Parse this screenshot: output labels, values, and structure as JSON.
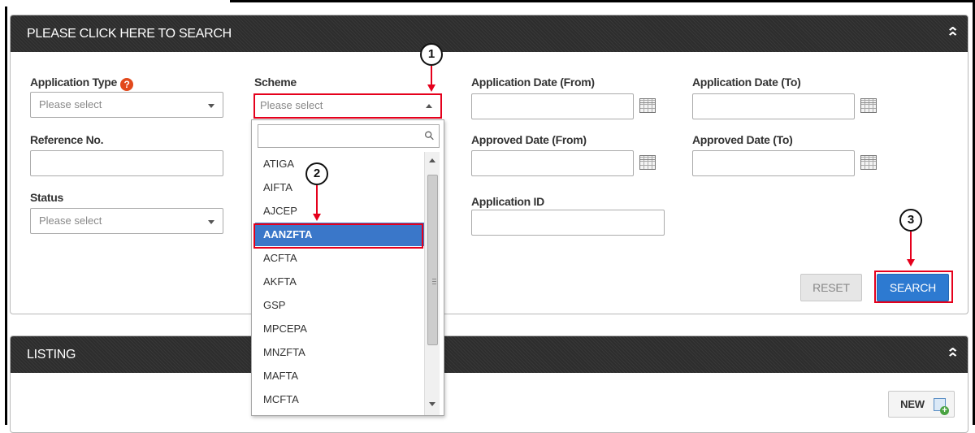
{
  "search_panel": {
    "title": "PLEASE CLICK HERE TO SEARCH",
    "collapse_glyph": "⌃",
    "fields": {
      "application_type": {
        "label": "Application Type",
        "placeholder": "Please select"
      },
      "scheme": {
        "label": "Scheme",
        "placeholder": "Please select"
      },
      "application_date_from": {
        "label": "Application Date (From)",
        "value": ""
      },
      "application_date_to": {
        "label": "Application Date (To)",
        "value": ""
      },
      "reference_no": {
        "label": "Reference No.",
        "value": ""
      },
      "approved_date_from": {
        "label": "Approved Date (From)",
        "value": ""
      },
      "approved_date_to": {
        "label": "Approved Date (To)",
        "value": ""
      },
      "status": {
        "label": "Status",
        "placeholder": "Please select"
      },
      "application_id": {
        "label": "Application ID",
        "value": ""
      }
    },
    "help_glyph": "?",
    "buttons": {
      "reset": "RESET",
      "search": "SEARCH"
    }
  },
  "scheme_dropdown": {
    "search_value": "",
    "search_icon_glyph": "⚲",
    "options": [
      "ATIGA",
      "AIFTA",
      "AJCEP",
      "AANZFTA",
      "ACFTA",
      "AKFTA",
      "GSP",
      "MPCEPA",
      "MNZFTA",
      "MAFTA",
      "MCFTA"
    ],
    "highlighted_option": "AANZFTA"
  },
  "listing_panel": {
    "title": "LISTING",
    "collapse_glyph": "⌃",
    "new_button": "NEW"
  },
  "callouts": [
    "1",
    "2",
    "3"
  ],
  "colors": {
    "header_bg": "#2d2d2d",
    "highlight_blue": "#3a77c9",
    "search_button": "#2d7ad1",
    "annotation_red": "#e5001c",
    "help_orange": "#e2491c"
  },
  "icons": [
    "help-icon",
    "calendar-icon",
    "collapse-icon",
    "search-icon",
    "new-document-icon"
  ]
}
